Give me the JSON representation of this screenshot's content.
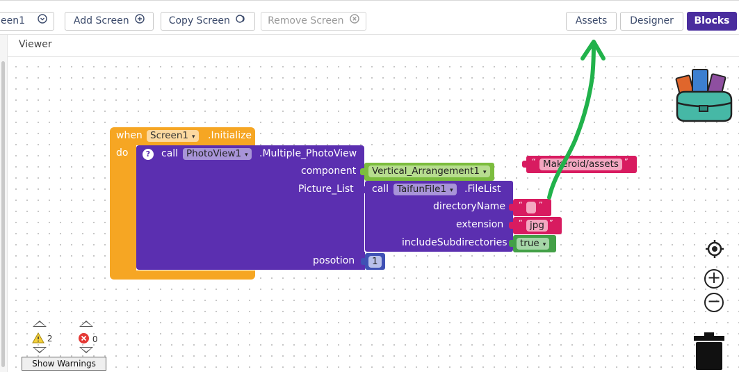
{
  "toolbar": {
    "screen_select": "een1",
    "add_screen": "Add Screen",
    "copy_screen": "Copy Screen",
    "remove_screen": "Remove Screen",
    "assets": "Assets",
    "designer": "Designer",
    "blocks": "Blocks"
  },
  "viewer": {
    "label": "Viewer"
  },
  "blocks": {
    "event": {
      "when": "when",
      "component": "Screen1",
      "event": ".Initialize",
      "do": "do"
    },
    "call1": {
      "call": "call",
      "component": "PhotoView1",
      "method": ".Multiple_PhotoView",
      "arg1": "component",
      "arg2": "Picture_List",
      "arg3": "posotion"
    },
    "component_value": "Vertical_Arrangement1",
    "call2": {
      "call": "call",
      "component": "TaifunFile1",
      "method": ".FileList",
      "arg1": "directoryName",
      "arg2": "extension",
      "arg3": "includeSubdirectories"
    },
    "dir_value": "",
    "ext_value": "jpg",
    "subdirs_value": "true",
    "position_value": "1",
    "loose_text": "Makeroid/assets",
    "help_mark": "?",
    "quote_open": "“",
    "quote_close": "”"
  },
  "warnings": {
    "warning_count": "2",
    "error_count": "0",
    "show_warnings": "Show Warnings"
  },
  "colors": {
    "event": "#f6a623",
    "procedure": "#5b2fb0",
    "text": "#d81b60",
    "logic": "#43a047",
    "component": "#7cbd3e",
    "math": "#3f51b5",
    "annotation": "#21b24b"
  },
  "icons": [
    "chevron-down-icon",
    "plus-circle-icon",
    "copy-icon",
    "x-circle-icon",
    "help-icon",
    "backpack-icon",
    "recenter-icon",
    "zoom-in-icon",
    "zoom-out-icon",
    "trash-icon",
    "warning-icon",
    "error-icon"
  ]
}
